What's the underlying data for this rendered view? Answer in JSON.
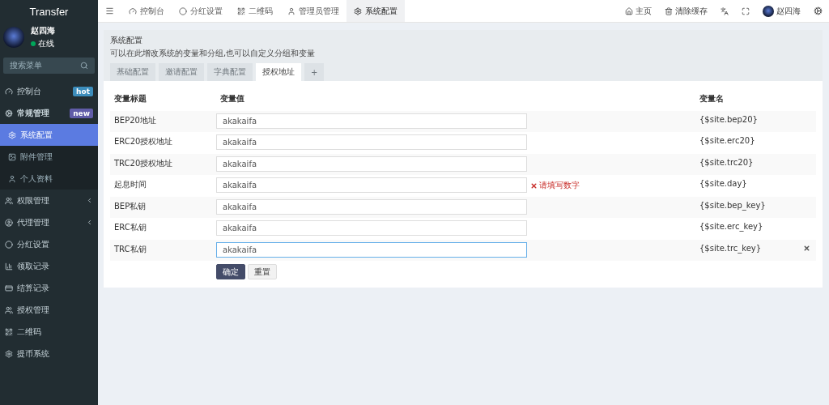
{
  "sidebar": {
    "brand": "Transfer",
    "user": {
      "name": "赵四海",
      "status": "在线"
    },
    "search": {
      "placeholder": "搜索菜单"
    },
    "items": [
      {
        "label": "控制台",
        "badge": {
          "text": "hot",
          "color": "#3c8dbc"
        },
        "arrow": false,
        "selected": false,
        "sub": false,
        "bold": false
      },
      {
        "label": "常规管理",
        "badge": {
          "text": "new",
          "color": "#605ca8"
        },
        "arrow": false,
        "selected": false,
        "sub": false,
        "bold": true
      },
      {
        "label": "系统配置",
        "arrow": false,
        "selected": true,
        "sub": true,
        "bold": false
      },
      {
        "label": "附件管理",
        "arrow": false,
        "selected": false,
        "sub": true,
        "bold": false
      },
      {
        "label": "个人资料",
        "arrow": false,
        "selected": false,
        "sub": true,
        "bold": false
      },
      {
        "label": "权限管理",
        "arrow": true,
        "selected": false,
        "sub": false,
        "bold": false
      },
      {
        "label": "代理管理",
        "arrow": true,
        "selected": false,
        "sub": false,
        "bold": false
      },
      {
        "label": "分红设置",
        "arrow": false,
        "selected": false,
        "sub": false,
        "bold": false
      },
      {
        "label": "领取记录",
        "arrow": false,
        "selected": false,
        "sub": false,
        "bold": false
      },
      {
        "label": "结算记录",
        "arrow": false,
        "selected": false,
        "sub": false,
        "bold": false
      },
      {
        "label": "授权管理",
        "arrow": false,
        "selected": false,
        "sub": false,
        "bold": false
      },
      {
        "label": "二维码",
        "arrow": false,
        "selected": false,
        "sub": false,
        "bold": false
      },
      {
        "label": "提币系统",
        "arrow": false,
        "selected": false,
        "sub": false,
        "bold": false
      }
    ]
  },
  "top_tabs": [
    {
      "label": "控制台",
      "selected": false
    },
    {
      "label": "分红设置",
      "selected": false
    },
    {
      "label": "二维码",
      "selected": false
    },
    {
      "label": "管理员管理",
      "selected": false
    },
    {
      "label": "系统配置",
      "selected": true
    }
  ],
  "top_right": {
    "home": "主页",
    "clear_cache": "清除缓存",
    "user": "赵四海"
  },
  "panel": {
    "title": "系统配置",
    "description": "可以在此增改系统的变量和分组,也可以自定义分组和变量",
    "tabs": [
      {
        "label": "基础配置",
        "selected": false
      },
      {
        "label": "邀请配置",
        "selected": false
      },
      {
        "label": "字典配置",
        "selected": false
      },
      {
        "label": "授权地址",
        "selected": true
      },
      {
        "label": "+",
        "selected": false
      }
    ],
    "columns": [
      "变量标题",
      "变量值",
      "变量名"
    ],
    "rows": [
      {
        "title": "BEP20地址",
        "value": "akakaifa",
        "name": "{$site.bep20}",
        "focused": false,
        "deletable": false
      },
      {
        "title": "ERC20授权地址",
        "value": "akakaifa",
        "name": "{$site.erc20}",
        "focused": false,
        "deletable": false
      },
      {
        "title": "TRC20授权地址",
        "value": "akakaifa",
        "name": "{$site.trc20}",
        "focused": false,
        "deletable": false
      },
      {
        "title": "起息时间",
        "value": "akakaifa",
        "name": "{$site.day}",
        "error": "请填写数字",
        "focused": false,
        "deletable": false
      },
      {
        "title": "BEP私钥",
        "value": "akakaifa",
        "name": "{$site.bep_key}",
        "focused": false,
        "deletable": false
      },
      {
        "title": "ERC私钥",
        "value": "akakaifa",
        "name": "{$site.erc_key}",
        "focused": false,
        "deletable": false
      },
      {
        "title": "TRC私钥",
        "value": "akakaifa",
        "name": "{$site.trc_key}",
        "focused": true,
        "deletable": true
      }
    ],
    "buttons": {
      "submit": "确定",
      "reset": "重置"
    }
  }
}
